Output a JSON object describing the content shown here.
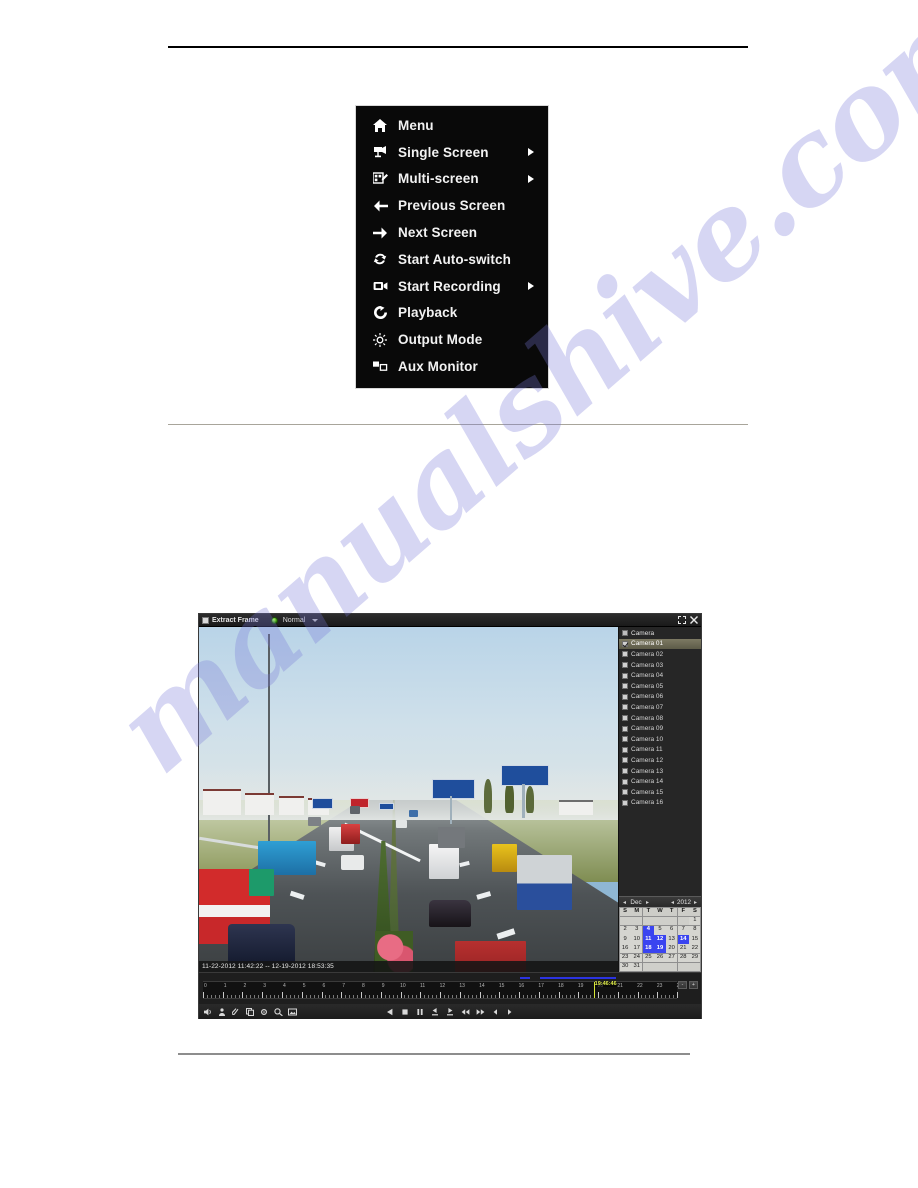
{
  "page": {
    "watermark": "manualshive.com"
  },
  "context_menu": {
    "items": [
      {
        "label": "Menu",
        "icon": "home-icon",
        "submenu": false
      },
      {
        "label": "Single Screen",
        "icon": "single-camera-icon",
        "submenu": true
      },
      {
        "label": "Multi-screen",
        "icon": "multi-screen-icon",
        "submenu": true
      },
      {
        "label": "Previous Screen",
        "icon": "arrow-left-icon",
        "submenu": false
      },
      {
        "label": "Next Screen",
        "icon": "arrow-right-icon",
        "submenu": false
      },
      {
        "label": "Start Auto-switch",
        "icon": "refresh-cycle-icon",
        "submenu": false
      },
      {
        "label": "Start Recording",
        "icon": "video-record-icon",
        "submenu": true
      },
      {
        "label": "Playback",
        "icon": "playback-icon",
        "submenu": false
      },
      {
        "label": "Output Mode",
        "icon": "brightness-icon",
        "submenu": false
      },
      {
        "label": "Aux Monitor",
        "icon": "aux-monitor-icon",
        "submenu": false
      }
    ]
  },
  "dvr": {
    "titlebar": {
      "extract_frame_label": "Extract Frame",
      "mode_value": "Normal",
      "maximize_icon": "maximize-icon",
      "close_icon": "close-icon"
    },
    "video": {
      "timestamp_range": "11-22-2012 11:42:22 -- 12-19-2012 18:53:35"
    },
    "camera_panel": {
      "header_label": "Camera",
      "selected": "Camera 01",
      "cameras": [
        "Camera 01",
        "Camera 02",
        "Camera 03",
        "Camera 04",
        "Camera 05",
        "Camera 06",
        "Camera 07",
        "Camera 08",
        "Camera 09",
        "Camera 10",
        "Camera 11",
        "Camera 12",
        "Camera 13",
        "Camera 14",
        "Camera 15",
        "Camera 16"
      ]
    },
    "calendar": {
      "month": "Dec",
      "year": "2012",
      "prev_month_icon": "chevron-left-icon",
      "next_month_icon": "chevron-right-icon",
      "prev_year_icon": "chevron-left-icon",
      "next_year_icon": "chevron-right-icon",
      "day_headers": [
        "S",
        "M",
        "T",
        "W",
        "T",
        "F",
        "S"
      ],
      "leading_blanks": 6,
      "days_in_month": 31,
      "recorded_days": [
        4,
        11,
        12,
        14,
        18,
        19
      ]
    },
    "timeline": {
      "hour_labels": [
        "0",
        "1",
        "2",
        "3",
        "4",
        "5",
        "6",
        "7",
        "8",
        "9",
        "10",
        "11",
        "12",
        "13",
        "14",
        "15",
        "16",
        "17",
        "18",
        "19",
        "20",
        "21",
        "22",
        "23",
        "24"
      ],
      "playhead_time": "19:46:46",
      "playhead_hour": 19.78,
      "progress_segments": [
        {
          "start_hour": 15.4,
          "end_hour": 15.9
        },
        {
          "start_hour": 16.4,
          "end_hour": 20.1
        }
      ],
      "zoom_out_label": "-",
      "zoom_in_label": "+"
    },
    "controls": {
      "left_tools": [
        "audio-icon",
        "person-filter-icon",
        "clip-icon",
        "copy-clip-icon",
        "settings-icon",
        "smart-search-icon",
        "snapshot-icon"
      ],
      "transport": [
        "play-reverse-icon",
        "stop-icon",
        "pause-icon",
        "frame-back-icon",
        "frame-forward-icon",
        "rewind-icon",
        "fast-forward-icon",
        "prev-file-icon",
        "next-file-icon"
      ]
    }
  }
}
